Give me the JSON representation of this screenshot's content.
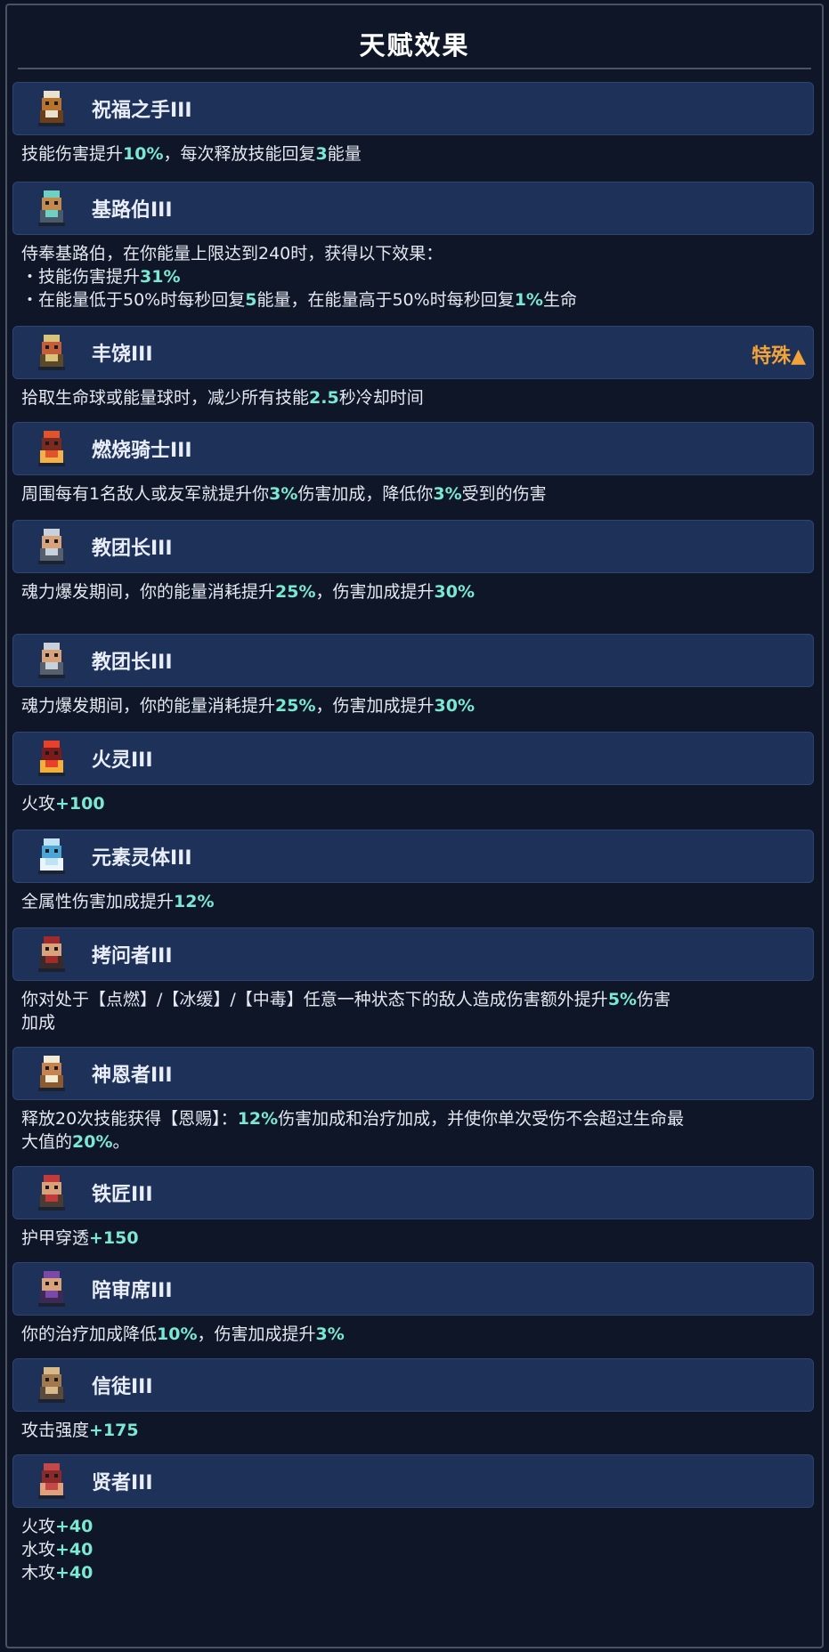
{
  "title": "天赋效果",
  "special_tag": "特殊▲",
  "talents": [
    {
      "name": "祝福之手III",
      "icon": "white-haired-elder-icon",
      "lines": [
        [
          [
            "技能伤害提升",
            0
          ],
          [
            "10%",
            1
          ],
          [
            "，每次释放技能回复",
            0
          ],
          [
            "3",
            1
          ],
          [
            "能量",
            0
          ]
        ]
      ]
    },
    {
      "name": "基路伯III",
      "icon": "winged-cherub-icon",
      "lines": [
        [
          [
            "侍奉基路伯，在你能量上限达到240时，获得以下效果：",
            0
          ]
        ],
        [
          [
            "・技能伤害提升",
            0
          ],
          [
            "31%",
            1
          ]
        ],
        [
          [
            "・在能量低于50%时每秒回复",
            0
          ],
          [
            "5",
            1
          ],
          [
            "能量，在能量高于50%时每秒回复",
            0
          ],
          [
            "1%",
            1
          ],
          [
            "生命",
            0
          ]
        ]
      ]
    },
    {
      "name": "丰饶III",
      "icon": "horned-warrior-icon",
      "special": true,
      "lines": [
        [
          [
            "拾取生命球或能量球时，减少所有技能",
            0
          ],
          [
            "2.5",
            1
          ],
          [
            "秒冷却时间",
            0
          ]
        ]
      ]
    },
    {
      "name": "燃烧骑士III",
      "icon": "flame-knight-icon",
      "lines": [
        [
          [
            "周围每有1名敌人或友军就提升你",
            0
          ],
          [
            "3%",
            1
          ],
          [
            "伤害加成，降低你",
            0
          ],
          [
            "3%",
            1
          ],
          [
            "受到的伤害",
            0
          ]
        ]
      ]
    },
    {
      "name": "教团长III",
      "icon": "order-leader-icon",
      "lines": [
        [
          [
            "魂力爆发期间，你的能量消耗提升",
            0
          ],
          [
            "25%",
            1
          ],
          [
            "，伤害加成提升",
            0
          ],
          [
            "30%",
            1
          ]
        ]
      ]
    },
    {
      "name": "教团长III",
      "icon": "order-leader-icon",
      "lines": [
        [
          [
            "魂力爆发期间，你的能量消耗提升",
            0
          ],
          [
            "25%",
            1
          ],
          [
            "，伤害加成提升",
            0
          ],
          [
            "30%",
            1
          ]
        ]
      ]
    },
    {
      "name": "火灵III",
      "icon": "fire-spirit-icon",
      "lines": [
        [
          [
            "火攻",
            0
          ],
          [
            "+100",
            1
          ]
        ]
      ]
    },
    {
      "name": "元素灵体III",
      "icon": "elemental-wizard-icon",
      "lines": [
        [
          [
            "全属性伤害加成提升",
            0
          ],
          [
            "12%",
            1
          ]
        ]
      ]
    },
    {
      "name": "拷问者III",
      "icon": "hooded-inquisitor-icon",
      "lines": [
        [
          [
            "你对处于【点燃】/【冰缓】/【中毒】任意一种状态下的敌人造成伤害额外提升",
            0
          ],
          [
            "5%",
            1
          ],
          [
            "伤害",
            0
          ]
        ],
        [
          [
            "加成",
            0
          ]
        ]
      ]
    },
    {
      "name": "神恩者III",
      "icon": "blessed-viking-icon",
      "lines": [
        [
          [
            "释放20次技能获得【恩赐】：",
            0
          ],
          [
            "12%",
            1
          ],
          [
            "伤害加成和治疗加成，并使你单次受伤不会超过生命最",
            0
          ]
        ],
        [
          [
            "大值的",
            0
          ],
          [
            "20%",
            1
          ],
          [
            "。",
            0
          ]
        ]
      ]
    },
    {
      "name": "铁匠III",
      "icon": "blacksmith-icon",
      "lines": [
        [
          [
            "护甲穿透",
            0
          ],
          [
            "+150",
            1
          ]
        ]
      ]
    },
    {
      "name": "陪审席III",
      "icon": "juror-icon",
      "lines": [
        [
          [
            "你的治疗加成降低",
            0
          ],
          [
            "10%",
            1
          ],
          [
            "，伤害加成提升",
            0
          ],
          [
            "3%",
            1
          ]
        ]
      ]
    },
    {
      "name": "信徒III",
      "icon": "believer-icon",
      "lines": [
        [
          [
            "攻击强度",
            0
          ],
          [
            "+175",
            1
          ]
        ]
      ]
    },
    {
      "name": "贤者III",
      "icon": "sage-icon",
      "lines": [
        [
          [
            "火攻",
            0
          ],
          [
            "+40",
            1
          ]
        ],
        [
          [
            "水攻",
            0
          ],
          [
            "+40",
            1
          ]
        ],
        [
          [
            "木攻",
            0
          ],
          [
            "+40",
            1
          ]
        ]
      ]
    }
  ]
}
